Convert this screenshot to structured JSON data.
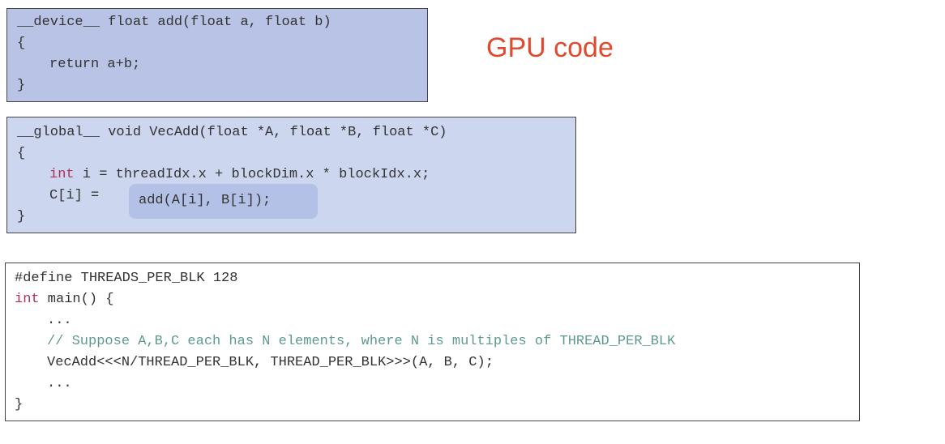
{
  "title": "GPU code",
  "device_block": {
    "lines": [
      "__device__ float add(float a, float b)",
      "{",
      "return a+b;",
      "}"
    ]
  },
  "global_block": {
    "signature": "__global__ void VecAdd(float *A, float *B, float *C)",
    "open_brace": "{",
    "line1_keyword": "int",
    "line1_rest": " i = threadIdx.x + blockDim.x * blockIdx.x;",
    "line2_prefix": "C[i] = ",
    "line2_highlight": "add(A[i], B[i]);",
    "close_brace": "}",
    "highlight_color": "#b3c1e6"
  },
  "host_block": {
    "define": "#define THREADS_PER_BLK 128",
    "main_keyword": "int",
    "main_rest": " main() {",
    "ellipsis1": "...",
    "comment": "// Suppose A,B,C each has N elements, where N is multiples of THREAD_PER_BLK",
    "launch": "VecAdd<<<N/THREAD_PER_BLK, THREAD_PER_BLK>>>(A, B, C);",
    "ellipsis2": "...",
    "close_brace": "}"
  },
  "colors": {
    "title": "#e04a2e",
    "keyword": "#b03060",
    "comment": "#5f9a90",
    "device_bg": "#b8c3e6",
    "global_bg": "#ccd6ee"
  }
}
